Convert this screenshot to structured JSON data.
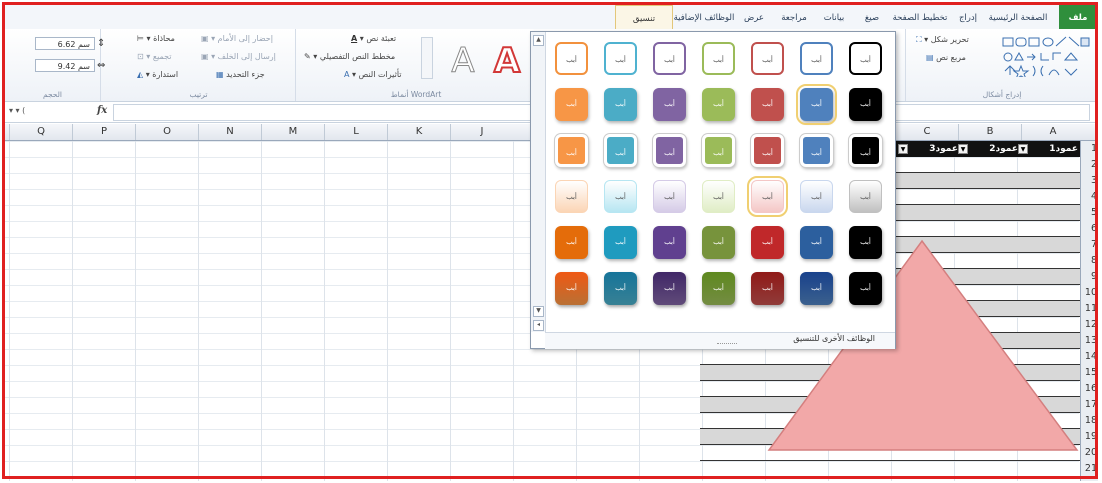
{
  "tabs": [
    {
      "label": "ملف",
      "active": false,
      "file": true
    },
    {
      "label": "الصفحة الرئيسية",
      "active": false
    },
    {
      "label": "إدراج",
      "active": false
    },
    {
      "label": "تخطيط الصفحة",
      "active": false
    },
    {
      "label": "صيغ",
      "active": false
    },
    {
      "label": "بيانات",
      "active": false
    },
    {
      "label": "مراجعة",
      "active": false
    },
    {
      "label": "عرض",
      "active": false
    },
    {
      "label": "الوظائف الإضافية",
      "active": false
    },
    {
      "label": "تنسيق",
      "active": true
    }
  ],
  "ribbon": {
    "insert_shapes": {
      "label": "إدراج أشكال",
      "edit_shape": "تحرير شكل",
      "text_box": "مربع نص"
    },
    "wordart": {
      "label": "أنماط WordArt",
      "text_fill": "تعبئة نص",
      "text_outline": "مخطط النص التفصيلي",
      "text_effects": "تأثيرات النص",
      "letter": "A"
    },
    "arrange": {
      "label": "ترتيب",
      "bring_forward": "إحضار إلى الأمام",
      "send_backward": "إرسال إلى الخلف",
      "selection_pane": "جزء التحديد",
      "align": "محاذاة",
      "group": "تجميع",
      "rotate": "استدارة"
    },
    "size": {
      "label": "الحجم",
      "height": "6.62 سم",
      "width": "9.42 سم"
    }
  },
  "formula_bar": {
    "fx": "fx",
    "value": ""
  },
  "columns": [
    "Q",
    "P",
    "O",
    "N",
    "M",
    "L",
    "K",
    "J",
    "C",
    "B",
    "A"
  ],
  "rows": [
    "1",
    "2",
    "3",
    "4",
    "5",
    "6",
    "7",
    "8",
    "9",
    "10",
    "11",
    "12",
    "13",
    "14",
    "15",
    "16",
    "17",
    "18",
    "19",
    "20",
    "21"
  ],
  "table": {
    "headers": [
      "عمود1",
      "عمود2",
      "عمود3"
    ]
  },
  "gallery": {
    "swatch_text": "أبب",
    "more_label": "الوظائف الأخرى للتنسيق",
    "rows": [
      {
        "style": "outline",
        "colors": [
          "#f2913d",
          "#4fb2d0",
          "#8064a2",
          "#9bbb59",
          "#c0504d",
          "#4f81bd",
          "#000000"
        ]
      },
      {
        "style": "solid",
        "colors": [
          "#f79646",
          "#4bacc6",
          "#8064a2",
          "#9bbb59",
          "#c0504d",
          "#4f81bd",
          "#000000"
        ]
      },
      {
        "style": "light",
        "colors": [
          "#f79646",
          "#4bacc6",
          "#8064a2",
          "#9bbb59",
          "#c0504d",
          "#4f81bd",
          "#000000"
        ]
      },
      {
        "style": "pastel",
        "colors": [
          "#fbd5b5",
          "#b7e6f2",
          "#d5cbe7",
          "#e0edc5",
          "#f4c7c6",
          "#c9d7ee",
          "#c0c0c0"
        ]
      },
      {
        "style": "intense",
        "colors": [
          "#e46c0a",
          "#1f9bbf",
          "#60408f",
          "#77933c",
          "#c0282a",
          "#2c5f9e",
          "#000000"
        ]
      },
      {
        "style": "gradient",
        "colors": [
          "#f79646",
          "#4bacc6",
          "#8064a2",
          "#9bbb59",
          "#c0504d",
          "#4f81bd",
          "#000000"
        ]
      }
    ],
    "selected": [
      [
        1,
        5
      ],
      [
        3,
        4
      ]
    ]
  },
  "colors": {
    "accent": "#e02020",
    "triangle_fill": "#f2a8a8",
    "triangle_stroke": "#d47f7f"
  }
}
